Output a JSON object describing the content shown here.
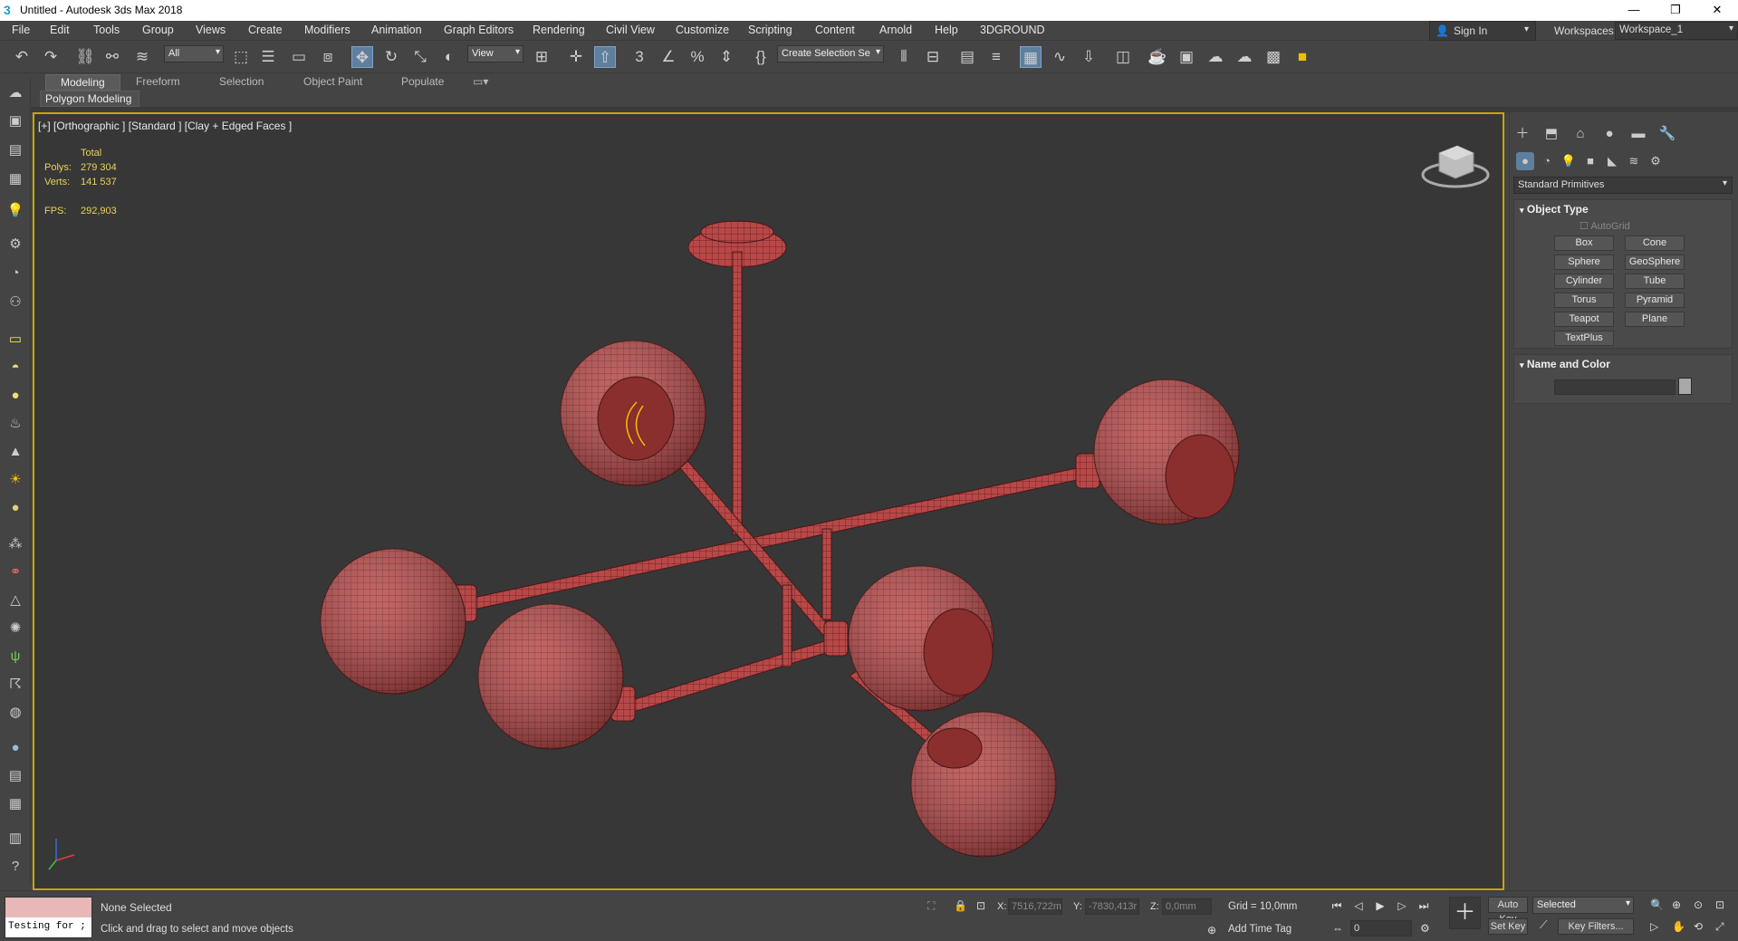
{
  "window": {
    "title": "Untitled - Autodesk 3ds Max 2018"
  },
  "menu": [
    "File",
    "Edit",
    "Tools",
    "Group",
    "Views",
    "Create",
    "Modifiers",
    "Animation",
    "Graph Editors",
    "Rendering",
    "Civil View",
    "Customize",
    "Scripting",
    "Content",
    "Arnold",
    "Help",
    "3DGROUND"
  ],
  "account": {
    "sign_in": "Sign In",
    "workspaces_label": "Workspaces:",
    "workspace": "Workspace_1"
  },
  "toolbar": {
    "filter": "All",
    "ref_coord": "View",
    "selection_set": "Create Selection Se"
  },
  "ribbon": {
    "tabs": [
      "Modeling",
      "Freeform",
      "Selection",
      "Object Paint",
      "Populate"
    ],
    "sub": "Polygon Modeling"
  },
  "viewport": {
    "label": "[+] [Orthographic ] [Standard ] [Clay + Edged Faces ]",
    "stats": {
      "total_label": "Total",
      "polys_label": "Polys:",
      "polys": "279 304",
      "verts_label": "Verts:",
      "verts": "141 537",
      "fps_label": "FPS:",
      "fps": "292,903"
    },
    "mesh_color": "#b84848"
  },
  "command_panel": {
    "category": "Standard Primitives",
    "object_type": {
      "header": "Object Type",
      "autogrid": "AutoGrid",
      "buttons": [
        "Box",
        "Cone",
        "Sphere",
        "GeoSphere",
        "Cylinder",
        "Tube",
        "Torus",
        "Pyramid",
        "Teapot",
        "Plane",
        "TextPlus"
      ]
    },
    "name_color": {
      "header": "Name and Color"
    }
  },
  "status": {
    "maxscript": "Testing for ;",
    "selection": "None Selected",
    "prompt": "Click and drag to select and move objects",
    "x_label": "X:",
    "x": "7516,722m",
    "y_label": "Y:",
    "y": "-7830,413r",
    "z_label": "Z:",
    "z": "0,0mm",
    "grid": "Grid = 10,0mm",
    "add_time_tag": "Add Time Tag",
    "frame": "0",
    "auto_key": "Auto Key",
    "set_key": "Set Key",
    "key_mode": "Selected",
    "key_filters": "Key Filters..."
  }
}
